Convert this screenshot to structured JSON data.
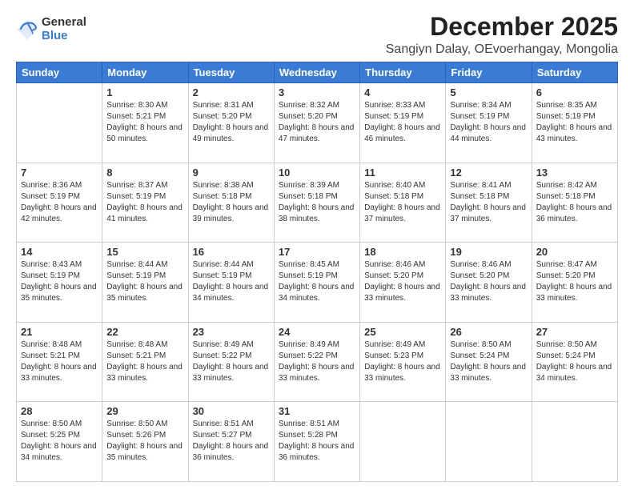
{
  "logo": {
    "general": "General",
    "blue": "Blue"
  },
  "title": "December 2025",
  "subtitle": "Sangiyn Dalay, OEvoerhangay, Mongolia",
  "days": [
    "Sunday",
    "Monday",
    "Tuesday",
    "Wednesday",
    "Thursday",
    "Friday",
    "Saturday"
  ],
  "weeks": [
    [
      {
        "date": "",
        "sunrise": "",
        "sunset": "",
        "daylight": ""
      },
      {
        "date": "1",
        "sunrise": "Sunrise: 8:30 AM",
        "sunset": "Sunset: 5:21 PM",
        "daylight": "Daylight: 8 hours and 50 minutes."
      },
      {
        "date": "2",
        "sunrise": "Sunrise: 8:31 AM",
        "sunset": "Sunset: 5:20 PM",
        "daylight": "Daylight: 8 hours and 49 minutes."
      },
      {
        "date": "3",
        "sunrise": "Sunrise: 8:32 AM",
        "sunset": "Sunset: 5:20 PM",
        "daylight": "Daylight: 8 hours and 47 minutes."
      },
      {
        "date": "4",
        "sunrise": "Sunrise: 8:33 AM",
        "sunset": "Sunset: 5:19 PM",
        "daylight": "Daylight: 8 hours and 46 minutes."
      },
      {
        "date": "5",
        "sunrise": "Sunrise: 8:34 AM",
        "sunset": "Sunset: 5:19 PM",
        "daylight": "Daylight: 8 hours and 44 minutes."
      },
      {
        "date": "6",
        "sunrise": "Sunrise: 8:35 AM",
        "sunset": "Sunset: 5:19 PM",
        "daylight": "Daylight: 8 hours and 43 minutes."
      }
    ],
    [
      {
        "date": "7",
        "sunrise": "Sunrise: 8:36 AM",
        "sunset": "Sunset: 5:19 PM",
        "daylight": "Daylight: 8 hours and 42 minutes."
      },
      {
        "date": "8",
        "sunrise": "Sunrise: 8:37 AM",
        "sunset": "Sunset: 5:19 PM",
        "daylight": "Daylight: 8 hours and 41 minutes."
      },
      {
        "date": "9",
        "sunrise": "Sunrise: 8:38 AM",
        "sunset": "Sunset: 5:18 PM",
        "daylight": "Daylight: 8 hours and 39 minutes."
      },
      {
        "date": "10",
        "sunrise": "Sunrise: 8:39 AM",
        "sunset": "Sunset: 5:18 PM",
        "daylight": "Daylight: 8 hours and 38 minutes."
      },
      {
        "date": "11",
        "sunrise": "Sunrise: 8:40 AM",
        "sunset": "Sunset: 5:18 PM",
        "daylight": "Daylight: 8 hours and 37 minutes."
      },
      {
        "date": "12",
        "sunrise": "Sunrise: 8:41 AM",
        "sunset": "Sunset: 5:18 PM",
        "daylight": "Daylight: 8 hours and 37 minutes."
      },
      {
        "date": "13",
        "sunrise": "Sunrise: 8:42 AM",
        "sunset": "Sunset: 5:18 PM",
        "daylight": "Daylight: 8 hours and 36 minutes."
      }
    ],
    [
      {
        "date": "14",
        "sunrise": "Sunrise: 8:43 AM",
        "sunset": "Sunset: 5:19 PM",
        "daylight": "Daylight: 8 hours and 35 minutes."
      },
      {
        "date": "15",
        "sunrise": "Sunrise: 8:44 AM",
        "sunset": "Sunset: 5:19 PM",
        "daylight": "Daylight: 8 hours and 35 minutes."
      },
      {
        "date": "16",
        "sunrise": "Sunrise: 8:44 AM",
        "sunset": "Sunset: 5:19 PM",
        "daylight": "Daylight: 8 hours and 34 minutes."
      },
      {
        "date": "17",
        "sunrise": "Sunrise: 8:45 AM",
        "sunset": "Sunset: 5:19 PM",
        "daylight": "Daylight: 8 hours and 34 minutes."
      },
      {
        "date": "18",
        "sunrise": "Sunrise: 8:46 AM",
        "sunset": "Sunset: 5:20 PM",
        "daylight": "Daylight: 8 hours and 33 minutes."
      },
      {
        "date": "19",
        "sunrise": "Sunrise: 8:46 AM",
        "sunset": "Sunset: 5:20 PM",
        "daylight": "Daylight: 8 hours and 33 minutes."
      },
      {
        "date": "20",
        "sunrise": "Sunrise: 8:47 AM",
        "sunset": "Sunset: 5:20 PM",
        "daylight": "Daylight: 8 hours and 33 minutes."
      }
    ],
    [
      {
        "date": "21",
        "sunrise": "Sunrise: 8:48 AM",
        "sunset": "Sunset: 5:21 PM",
        "daylight": "Daylight: 8 hours and 33 minutes."
      },
      {
        "date": "22",
        "sunrise": "Sunrise: 8:48 AM",
        "sunset": "Sunset: 5:21 PM",
        "daylight": "Daylight: 8 hours and 33 minutes."
      },
      {
        "date": "23",
        "sunrise": "Sunrise: 8:49 AM",
        "sunset": "Sunset: 5:22 PM",
        "daylight": "Daylight: 8 hours and 33 minutes."
      },
      {
        "date": "24",
        "sunrise": "Sunrise: 8:49 AM",
        "sunset": "Sunset: 5:22 PM",
        "daylight": "Daylight: 8 hours and 33 minutes."
      },
      {
        "date": "25",
        "sunrise": "Sunrise: 8:49 AM",
        "sunset": "Sunset: 5:23 PM",
        "daylight": "Daylight: 8 hours and 33 minutes."
      },
      {
        "date": "26",
        "sunrise": "Sunrise: 8:50 AM",
        "sunset": "Sunset: 5:24 PM",
        "daylight": "Daylight: 8 hours and 33 minutes."
      },
      {
        "date": "27",
        "sunrise": "Sunrise: 8:50 AM",
        "sunset": "Sunset: 5:24 PM",
        "daylight": "Daylight: 8 hours and 34 minutes."
      }
    ],
    [
      {
        "date": "28",
        "sunrise": "Sunrise: 8:50 AM",
        "sunset": "Sunset: 5:25 PM",
        "daylight": "Daylight: 8 hours and 34 minutes."
      },
      {
        "date": "29",
        "sunrise": "Sunrise: 8:50 AM",
        "sunset": "Sunset: 5:26 PM",
        "daylight": "Daylight: 8 hours and 35 minutes."
      },
      {
        "date": "30",
        "sunrise": "Sunrise: 8:51 AM",
        "sunset": "Sunset: 5:27 PM",
        "daylight": "Daylight: 8 hours and 36 minutes."
      },
      {
        "date": "31",
        "sunrise": "Sunrise: 8:51 AM",
        "sunset": "Sunset: 5:28 PM",
        "daylight": "Daylight: 8 hours and 36 minutes."
      },
      {
        "date": "",
        "sunrise": "",
        "sunset": "",
        "daylight": ""
      },
      {
        "date": "",
        "sunrise": "",
        "sunset": "",
        "daylight": ""
      },
      {
        "date": "",
        "sunrise": "",
        "sunset": "",
        "daylight": ""
      }
    ]
  ]
}
